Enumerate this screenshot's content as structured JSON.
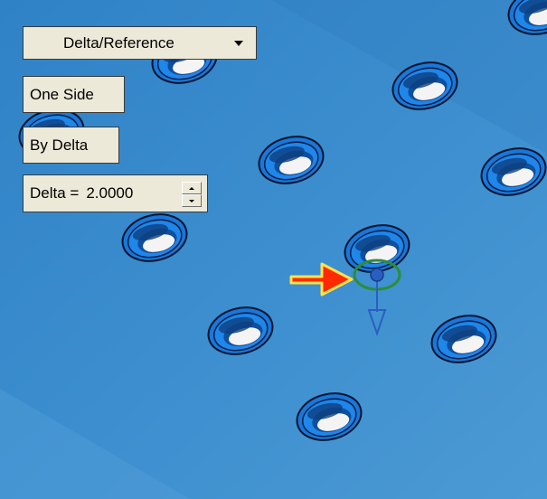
{
  "toolbar": {
    "mode_dropdown_value": "Delta/Reference",
    "side_option": "One Side",
    "delta_option": "By Delta",
    "delta_label": "Delta =",
    "delta_value": "2.0000"
  },
  "icons": [
    "chevron-down-icon",
    "spinner-up-icon",
    "spinner-down-icon",
    "pointer-arrow-icon",
    "direction-arrow-icon"
  ],
  "colors": {
    "surface": "#3d8dc9",
    "hole_rim": "#1a77d8",
    "pointer_arrow": "#ff2a00",
    "pointer_outline": "#ffe14a",
    "handle": "#2a5fc2",
    "selection_ring": "#2c8d3a",
    "panel": "#ece9d8"
  }
}
